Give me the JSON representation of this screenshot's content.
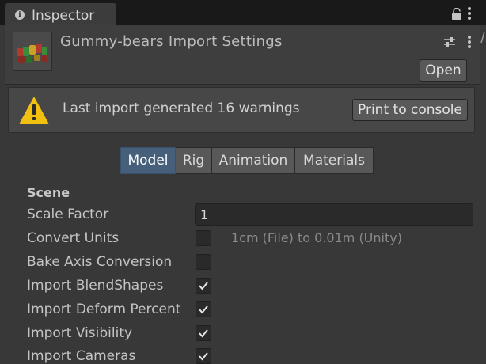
{
  "window": {
    "tab_title": "Inspector",
    "tab_info_glyph": "i",
    "icons": [
      "info-icon",
      "lock-icon",
      "kebab-menu-icon"
    ]
  },
  "header": {
    "title": "Gummy-bears Import Settings",
    "open_label": "Open",
    "icons": [
      "asset-thumbnail",
      "settings-sliders-icon",
      "kebab-menu-icon"
    ]
  },
  "warning": {
    "message": "Last import generated 16 warnings",
    "print_label": "Print to console",
    "icon": "warning-icon"
  },
  "tabs": [
    {
      "label": "Model",
      "active": true
    },
    {
      "label": "Rig",
      "active": false
    },
    {
      "label": "Animation",
      "active": false
    },
    {
      "label": "Materials",
      "active": false
    }
  ],
  "scene": {
    "title": "Scene",
    "scale_factor_label": "Scale Factor",
    "scale_factor_value": "1",
    "convert_units_label": "Convert Units",
    "convert_units_checked": false,
    "convert_units_hint": "1cm (File) to 0.01m (Unity)",
    "bake_axis_label": "Bake Axis Conversion",
    "bake_axis_checked": false,
    "import_blendshapes_label": "Import BlendShapes",
    "import_blendshapes_checked": true,
    "import_deform_label": "Import Deform Percent",
    "import_deform_checked": true,
    "import_visibility_label": "Import Visibility",
    "import_visibility_checked": true,
    "import_cameras_label": "Import Cameras",
    "import_cameras_checked": true
  },
  "colors": {
    "background": "#383838",
    "active_tab": "#46607c",
    "warning_yellow": "#f2c00f"
  }
}
